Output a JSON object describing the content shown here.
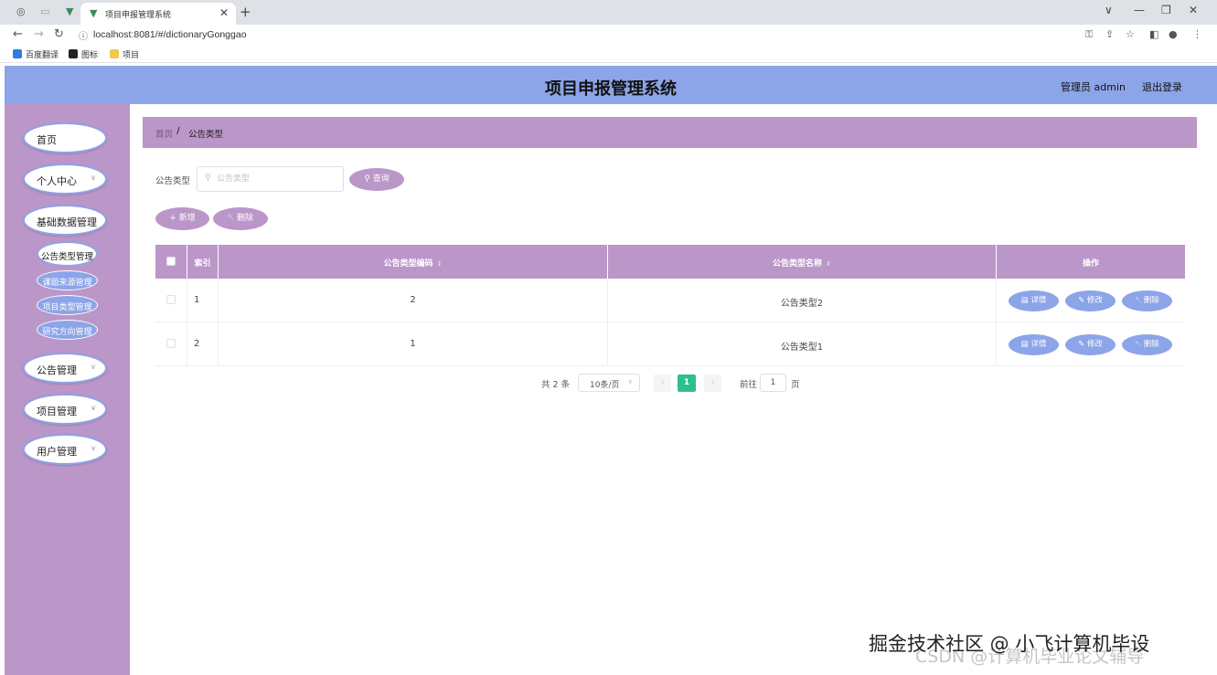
{
  "browser": {
    "tab_title": "项目申报管理系统",
    "url": "localhost:8081/#/dictionaryGonggao",
    "bookmarks": [
      "百度翻译",
      "图标",
      "项目"
    ]
  },
  "header": {
    "title": "项目申报管理系统",
    "user": "管理员 admin",
    "logout": "退出登录"
  },
  "sidebar": {
    "items": [
      {
        "label": "首页"
      },
      {
        "label": "个人中心"
      },
      {
        "label": "基础数据管理"
      },
      {
        "label": "公告管理"
      },
      {
        "label": "项目管理"
      },
      {
        "label": "用户管理"
      }
    ],
    "sub_items": [
      {
        "label": "公告类型管理"
      },
      {
        "label": "课题来源管理"
      },
      {
        "label": "项目类型管理"
      },
      {
        "label": "研究方向管理"
      }
    ]
  },
  "breadcrumb": {
    "home": "首页",
    "separator": "/",
    "current": "公告类型"
  },
  "search": {
    "label": "公告类型",
    "placeholder": "公告类型",
    "value": "",
    "query_button": "查询"
  },
  "toolbar": {
    "add": "新增",
    "delete": "删除"
  },
  "table": {
    "columns": {
      "index": "索引",
      "code": "公告类型编码",
      "name": "公告类型名称",
      "ops": "操作"
    },
    "rows": [
      {
        "index": "1",
        "code": "2",
        "name": "公告类型2"
      },
      {
        "index": "2",
        "code": "1",
        "name": "公告类型1"
      }
    ],
    "actions": {
      "detail": "详情",
      "edit": "修改",
      "delete": "删除"
    }
  },
  "pagination": {
    "total": "共 2 条",
    "page_size": "10条/页",
    "current": "1",
    "goto_label": "前往",
    "goto_value": "1",
    "goto_unit": "页"
  },
  "watermark": {
    "line1": "掘金技术社区 @ 小飞计算机毕设",
    "line2": "CSDN @计算机毕业论文辅导"
  },
  "colors": {
    "header": "#8ca4e8",
    "sidebar": "#bb96c8",
    "accent": "#8ca4e8",
    "active_page": "#2dbe92"
  }
}
